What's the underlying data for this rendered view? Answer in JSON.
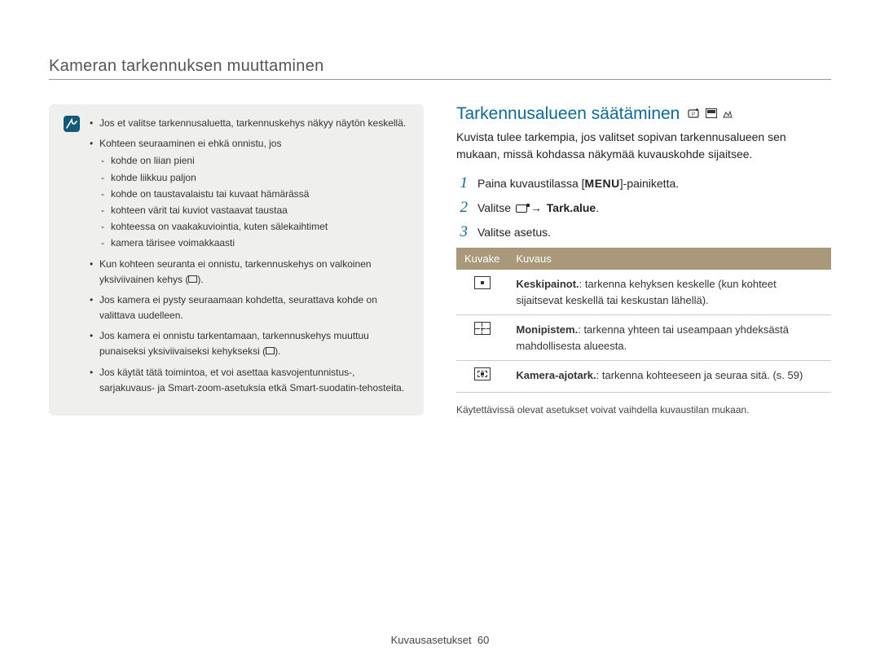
{
  "page_title": "Kameran tarkennuksen muuttaminen",
  "note": {
    "items": [
      {
        "text": "Jos et valitse tarkennusaluetta, tarkennuskehys näkyy näytön keskellä."
      },
      {
        "text": "Kohteen seuraaminen ei ehkä onnistu, jos",
        "sub": [
          "kohde on liian pieni",
          "kohde liikkuu paljon",
          "kohde on taustavalaistu tai kuvaat hämärässä",
          "kohteen värit tai kuviot vastaavat taustaa",
          "kohteessa on vaakakuviointia, kuten sälekaihtimet",
          "kamera tärisee voimakkaasti"
        ]
      },
      {
        "text_pre": "Kun kohteen seuranta ei onnistu, tarkennuskehys on valkoinen yksiviivainen kehys (",
        "text_post": ")."
      },
      {
        "text": "Jos kamera ei pysty seuraamaan kohdetta, seurattava kohde on valittava uudelleen."
      },
      {
        "text_pre": "Jos kamera ei onnistu tarkentamaan, tarkennuskehys muuttuu punaiseksi yksiviivaiseksi kehykseksi (",
        "text_post": ")."
      },
      {
        "text": "Jos käytät tätä toimintoa, et voi asettaa kasvojentunnistus-, sarjakuvaus- ja Smart-zoom-asetuksia etkä Smart-suodatin-tehosteita."
      }
    ]
  },
  "section": {
    "heading": "Tarkennusalueen säätäminen",
    "intro": "Kuvista tulee tarkempia, jos valitset sopivan tarkennusalueen sen mukaan, missä kohdassa näkymää kuvauskohde sijaitsee.",
    "steps": {
      "s1_pre": "Paina kuvaustilassa [",
      "s1_menu": "MENU",
      "s1_post": "]-painiketta.",
      "s2_pre": "Valitse ",
      "s2_arrow": "→",
      "s2_bold": "Tark.alue",
      "s2_post": ".",
      "s3": "Valitse asetus."
    },
    "table": {
      "header_icon": "Kuvake",
      "header_desc": "Kuvaus",
      "rows": [
        {
          "icon": "center",
          "bold": "Keskipainot.",
          "text": ": tarkenna kehyksen keskelle (kun kohteet sijaitsevat keskellä tai keskustan lähellä)."
        },
        {
          "icon": "grid",
          "bold": "Monipistem.",
          "text": ": tarkenna yhteen tai useampaan yhdeksästä mahdollisesta alueesta."
        },
        {
          "icon": "track",
          "bold": "Kamera-ajotark.",
          "text": ": tarkenna kohteeseen ja seuraa sitä. (s. 59)"
        }
      ]
    },
    "footnote": "Käytettävissä olevat asetukset voivat vaihdella kuvaustilan mukaan."
  },
  "footer": {
    "section_name": "Kuvausasetukset",
    "page_num": "60"
  }
}
